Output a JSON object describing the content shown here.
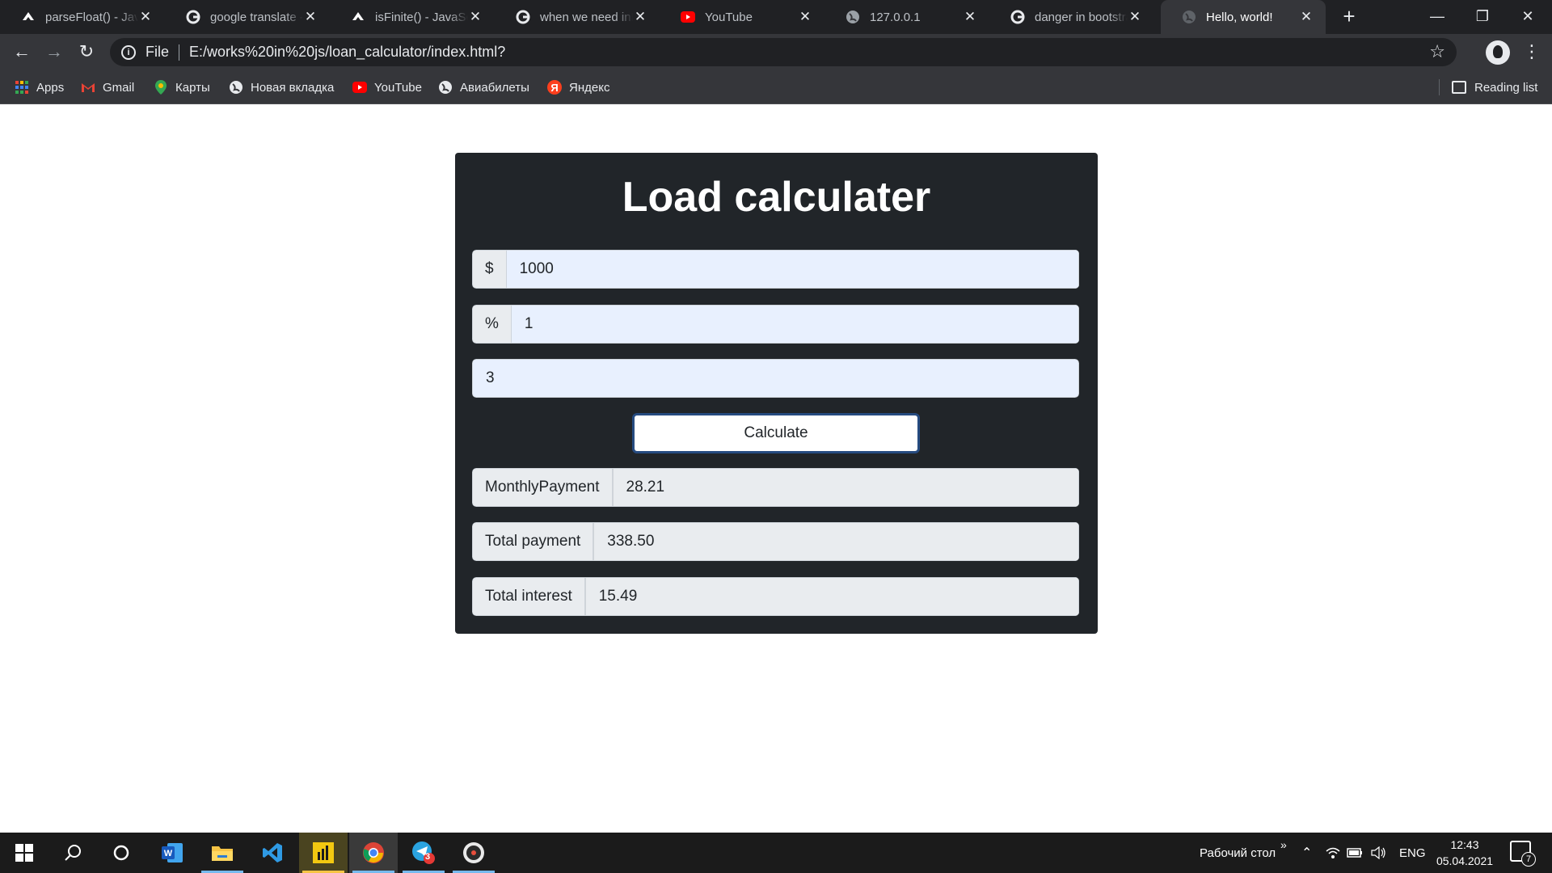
{
  "browser": {
    "tabs": [
      {
        "title": "parseFloat() - JavaScript",
        "icon": "mdn-icon",
        "active": false
      },
      {
        "title": "google translate - Google Search",
        "icon": "google-icon",
        "active": false
      },
      {
        "title": "isFinite() - JavaScript",
        "icon": "mdn-icon",
        "active": false
      },
      {
        "title": "when we need inFinite",
        "icon": "google-icon",
        "active": false
      },
      {
        "title": "YouTube",
        "icon": "youtube-icon",
        "active": false
      },
      {
        "title": "127.0.0.1",
        "icon": "globe-icon",
        "active": false
      },
      {
        "title": "danger in bootstrap",
        "icon": "google-icon",
        "active": false
      },
      {
        "title": "Hello, world!",
        "icon": "globe-icon",
        "active": true
      }
    ],
    "address": {
      "scheme_label": "File",
      "url": "E:/works%20in%20js/loan_calculator/index.html?"
    },
    "bookmarks": [
      {
        "label": "Apps",
        "icon": "apps-grid-icon"
      },
      {
        "label": "Gmail",
        "icon": "gmail-icon"
      },
      {
        "label": "Карты",
        "icon": "maps-icon"
      },
      {
        "label": "Новая вкладка",
        "icon": "globe-icon"
      },
      {
        "label": "YouTube",
        "icon": "youtube-icon"
      },
      {
        "label": "Авиабилеты",
        "icon": "globe-icon"
      },
      {
        "label": "Яндекс",
        "icon": "yandex-icon"
      }
    ],
    "reading_list": "Reading list"
  },
  "calculator": {
    "title": "Load calculater",
    "amount": {
      "addon": "$",
      "value": "1000"
    },
    "interest": {
      "addon": "%",
      "value": "1"
    },
    "years": {
      "value": "3"
    },
    "calculate_label": "Calculate",
    "results": {
      "monthly": {
        "label": "MonthlyPayment",
        "value": "28.21"
      },
      "total_payment": {
        "label": "Total payment",
        "value": "338.50"
      },
      "total_interest": {
        "label": "Total interest",
        "value": "15.49"
      }
    }
  },
  "taskbar": {
    "desktop_label": "Рабочий стол",
    "language": "ENG",
    "time": "12:43",
    "date": "05.04.2021",
    "telegram_badge": "3",
    "notifications_count": "7"
  },
  "colors": {
    "card_bg": "#212529",
    "input_autofill_bg": "#e8f0fe",
    "addon_bg": "#e9ecef",
    "button_border": "#264b80"
  }
}
